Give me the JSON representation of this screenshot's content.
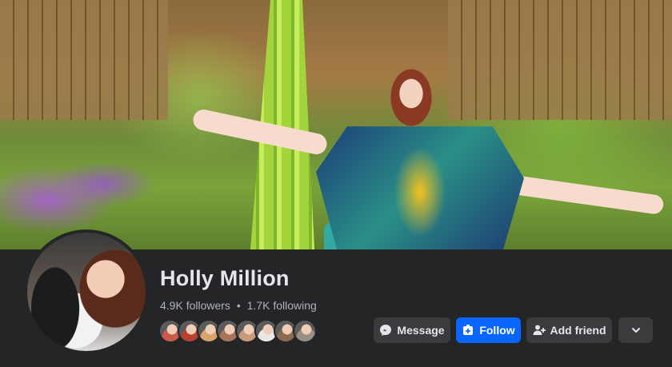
{
  "profile": {
    "name": "Holly Million",
    "followers": "4.9K followers",
    "separator": "•",
    "following": "1.7K following"
  },
  "friends_preview": {
    "colors": [
      "#c95b4a",
      "#b8412f",
      "#d9a36a",
      "#a8745a",
      "#c99a7a",
      "#e8e8e8",
      "#8b6b4f",
      "#9a8f86"
    ]
  },
  "actions": {
    "message_label": "Message",
    "follow_label": "Follow",
    "add_friend_label": "Add friend",
    "more_icon": "chevron-down-icon"
  },
  "colors": {
    "background": "#242526",
    "button_bg": "#3a3b3c",
    "accent": "#0866ff",
    "text_primary": "#e4e6eb",
    "text_secondary": "#b0b3b8"
  }
}
